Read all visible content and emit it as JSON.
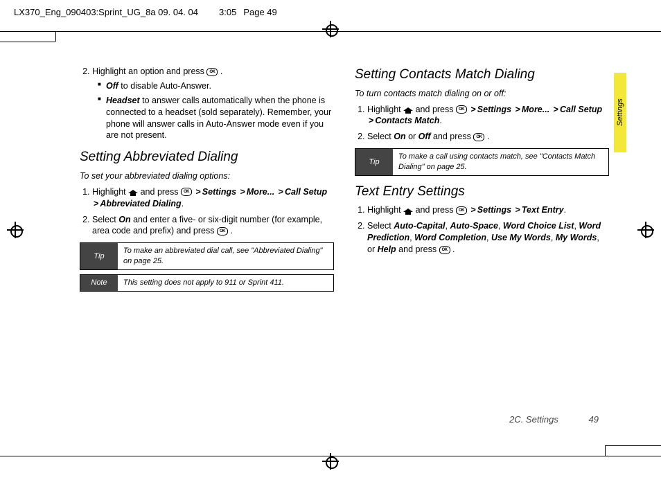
{
  "header": {
    "doc_id": "LX370_Eng_090403:Sprint_UG_8a  09. 04. 04",
    "time": "3:05",
    "page_label": "Page 49"
  },
  "side_tab": "Settings",
  "left": {
    "step2_intro": "Highlight an option and press ",
    "off_label": "Off",
    "off_text": " to disable Auto-Answer.",
    "headset_label": "Headset",
    "headset_text": "  to answer calls automatically when the phone is connected to a headset (sold separately). Remember, your phone will answer calls in Auto-Answer mode even if you are not present.",
    "abbr_heading": "Setting Abbreviated Dialing",
    "abbr_lead": "To set your abbreviated dialing options:",
    "abbr_step1_a": "Highlight ",
    "abbr_step1_b": " and press ",
    "abbr_path1": "Settings",
    "abbr_path2": "More...",
    "abbr_path3": "Call Setup",
    "abbr_path4": "Abbreviated Dialing",
    "abbr_step2_a": "Select ",
    "abbr_step2_on": "On",
    "abbr_step2_b": " and enter a five- or six-digit number (for example, area code and prefix) and press ",
    "tip_label": "Tip",
    "tip_text": "To make an abbreviated dial call, see \"Abbreviated Dialing\" on page 25.",
    "note_label": "Note",
    "note_text": "This setting does not apply to 911 or Sprint 411."
  },
  "right": {
    "cm_heading": "Setting Contacts Match Dialing",
    "cm_lead": "To turn contacts match dialing on or off:",
    "cm_step1_a": "Highlight ",
    "cm_step1_b": " and press ",
    "cm_path1": "Settings",
    "cm_path2": "More...",
    "cm_path3": "Call Setup",
    "cm_path4": "Contacts Match",
    "cm_step2_a": "Select ",
    "cm_step2_on": "On",
    "cm_step2_or": " or ",
    "cm_step2_off": "Off",
    "cm_step2_b": " and press ",
    "cm_tip_label": "Tip",
    "cm_tip_text": "To make a call using contacts match, see \"Contacts Match Dialing\" on page 25.",
    "te_heading": "Text Entry Settings",
    "te_step1_a": "Highlight ",
    "te_step1_b": " and press ",
    "te_path1": "Settings",
    "te_path2": "Text Entry",
    "te_step2_a": "Select ",
    "te_opt1": "Auto-Capital",
    "te_opt2": "Auto-Space",
    "te_opt3": "Word Choice List",
    "te_opt4": "Word Prediction",
    "te_opt5": "Word Completion",
    "te_opt6": "Use My Words",
    "te_opt7": "My Words",
    "te_or": ", or ",
    "te_opt8": "Help",
    "te_step2_b": " and press "
  },
  "footer": {
    "section": "2C. Settings",
    "page": "49"
  },
  "period": ".",
  "comma": ", ",
  "gt": ">"
}
